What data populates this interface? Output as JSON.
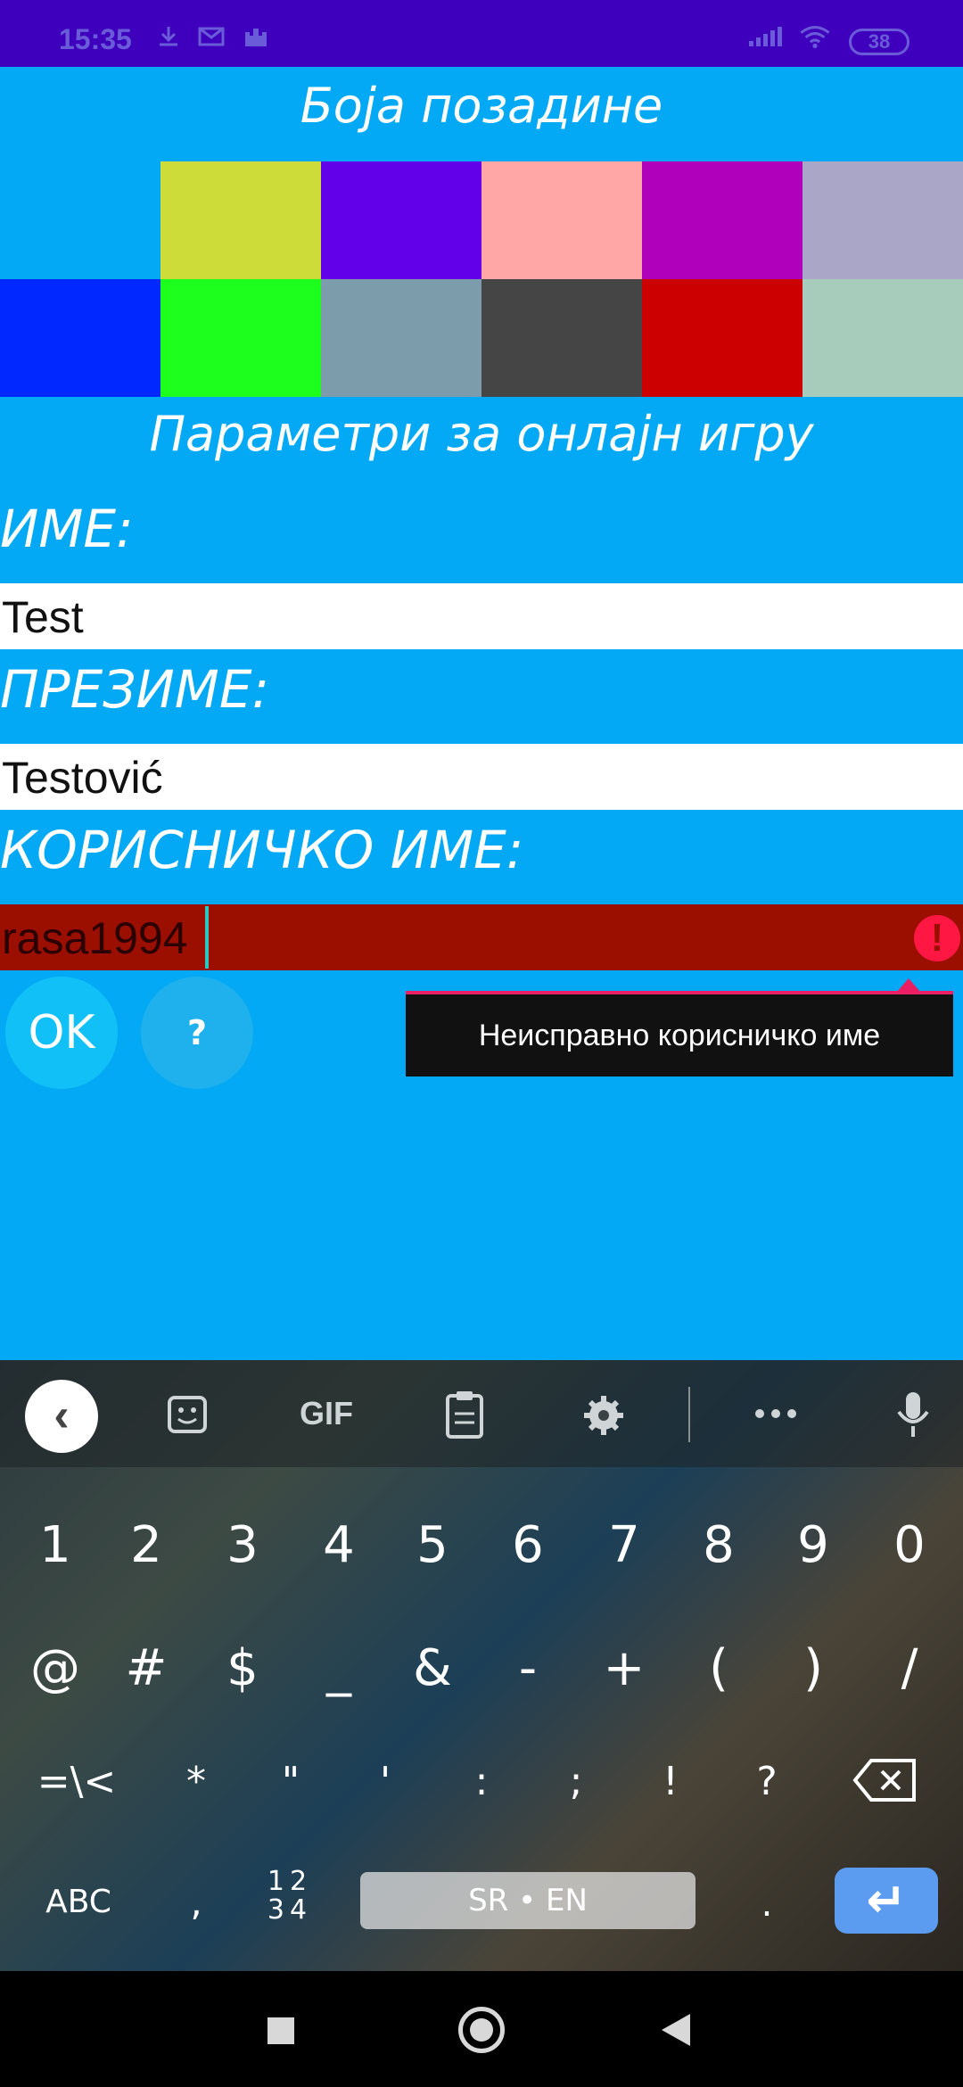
{
  "status_bar": {
    "time": "15:35",
    "battery": "38",
    "icons": [
      "download-icon",
      "mail-icon",
      "castle-icon",
      "signal-icon",
      "wifi-icon"
    ]
  },
  "background_section": {
    "title": "Боја позадине",
    "swatches": [
      "#03A9F4",
      "#CDDC39",
      "#6200EA",
      "#FFA6A6",
      "#B000BB",
      "#AAA6C8",
      "#0028FF",
      "#1DFF1D",
      "#7C9CAC",
      "#454545",
      "#CC0000",
      "#A8CCBC"
    ]
  },
  "online_section": {
    "title": "Параметри за онлајн игру"
  },
  "form": {
    "first_name_label": "ИМЕ:",
    "first_name_value": "Test",
    "last_name_label": "ПРЕЗИМЕ:",
    "last_name_value": "Testović",
    "username_label": "КОРИСНИЧКО ИМЕ:",
    "username_value": "rasa1994",
    "error_text": "Неисправно корисничко име"
  },
  "buttons": {
    "ok": "OK",
    "help": "?"
  },
  "keyboard": {
    "toolbar": {
      "gif": "GIF"
    },
    "row1": [
      "1",
      "2",
      "3",
      "4",
      "5",
      "6",
      "7",
      "8",
      "9",
      "0"
    ],
    "row2": [
      "@",
      "#",
      "$",
      "_",
      "&",
      "-",
      "+",
      "(",
      ")",
      "/"
    ],
    "row3": [
      "=\\<",
      "*",
      "\"",
      "'",
      ":",
      ";",
      "!",
      "?"
    ],
    "abc": "ABC",
    "comma": ",",
    "numpad": "12 34",
    "space": "SR • EN",
    "period": "."
  },
  "colors": {
    "app_background": "#03A9F4",
    "status_bar": "#3F00BE",
    "error_field": "#9B0F00",
    "error_accent": "#E91E63",
    "enter_key": "#5B9CF0"
  }
}
